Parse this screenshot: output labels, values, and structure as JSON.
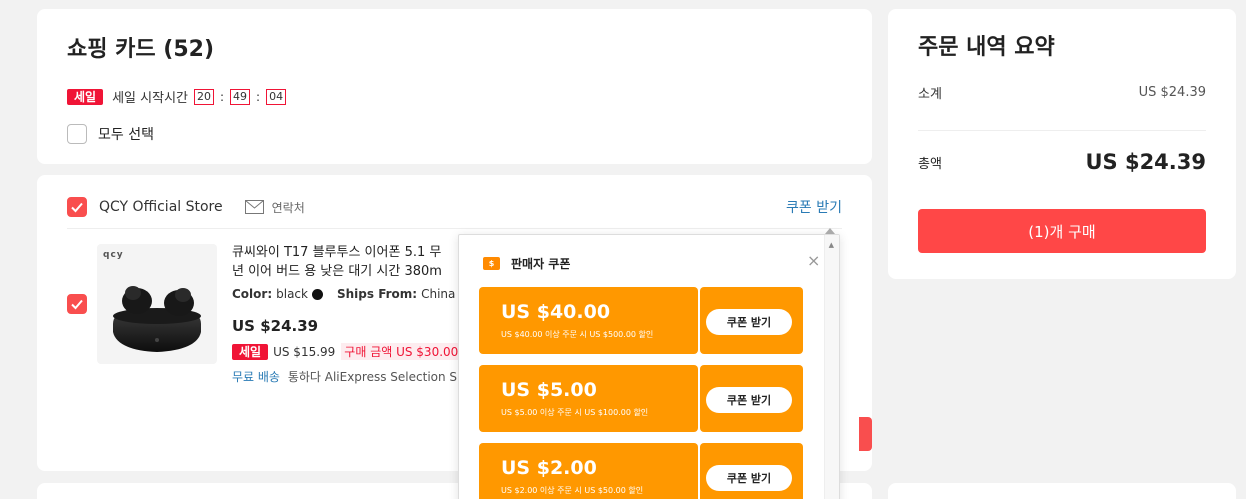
{
  "cart": {
    "title": "쇼핑 카드 (52)",
    "sale_badge": "세일",
    "sale_start_label": "세일 시작시간",
    "timer": {
      "hours": "20",
      "minutes": "49",
      "seconds": "04"
    },
    "select_all_label": "모두 선택",
    "select_all_checked": false
  },
  "store": {
    "name": "QCY Official Store",
    "contact_label": "연락처",
    "coupon_link": "쿠폰 받기",
    "checked": true,
    "item": {
      "checked": true,
      "thumb_logo": "qcy",
      "title_line1": "큐씨와이 T17 블루투스 이어폰 5.1 무",
      "title_line2": "년 이어 버드 용 낮은 대기 시간 380m",
      "color_label": "Color:",
      "color_value": "black",
      "ships_label": "Ships From:",
      "ships_value": "China",
      "price": "US $24.39",
      "sale_badge": "세일",
      "sale_price": "US $15.99",
      "min_purchase": "구매 금액 US $30.00",
      "free_shipping": "무료 배송",
      "ship_via": "통하다 AliExpress Selection Shi"
    }
  },
  "summary": {
    "title": "주문 내역 요약",
    "subtotal_label": "소계",
    "subtotal_value": "US $24.39",
    "total_label": "총액",
    "total_value": "US $24.39",
    "buy_button": "(1)개 구매"
  },
  "coupon_popup": {
    "title": "판매자 쿠폰",
    "ticket_symbol": "$",
    "close_symbol": "×",
    "coupons": [
      {
        "amount": "US $40.00",
        "condition": "US $40.00 이상 주문 시 US $500.00 할인",
        "button": "쿠폰 받기"
      },
      {
        "amount": "US $5.00",
        "condition": "US $5.00 이상 주문 시 US $100.00 할인",
        "button": "쿠폰 받기"
      },
      {
        "amount": "US $2.00",
        "condition": "US $2.00 이상 주문 시 US $50.00 할인",
        "button": "쿠폰 받기"
      }
    ]
  },
  "colors": {
    "accent_red": "#ff4747",
    "sale_red": "#f01436",
    "coupon_orange": "#ff9800",
    "link_blue": "#2a7bb5"
  }
}
